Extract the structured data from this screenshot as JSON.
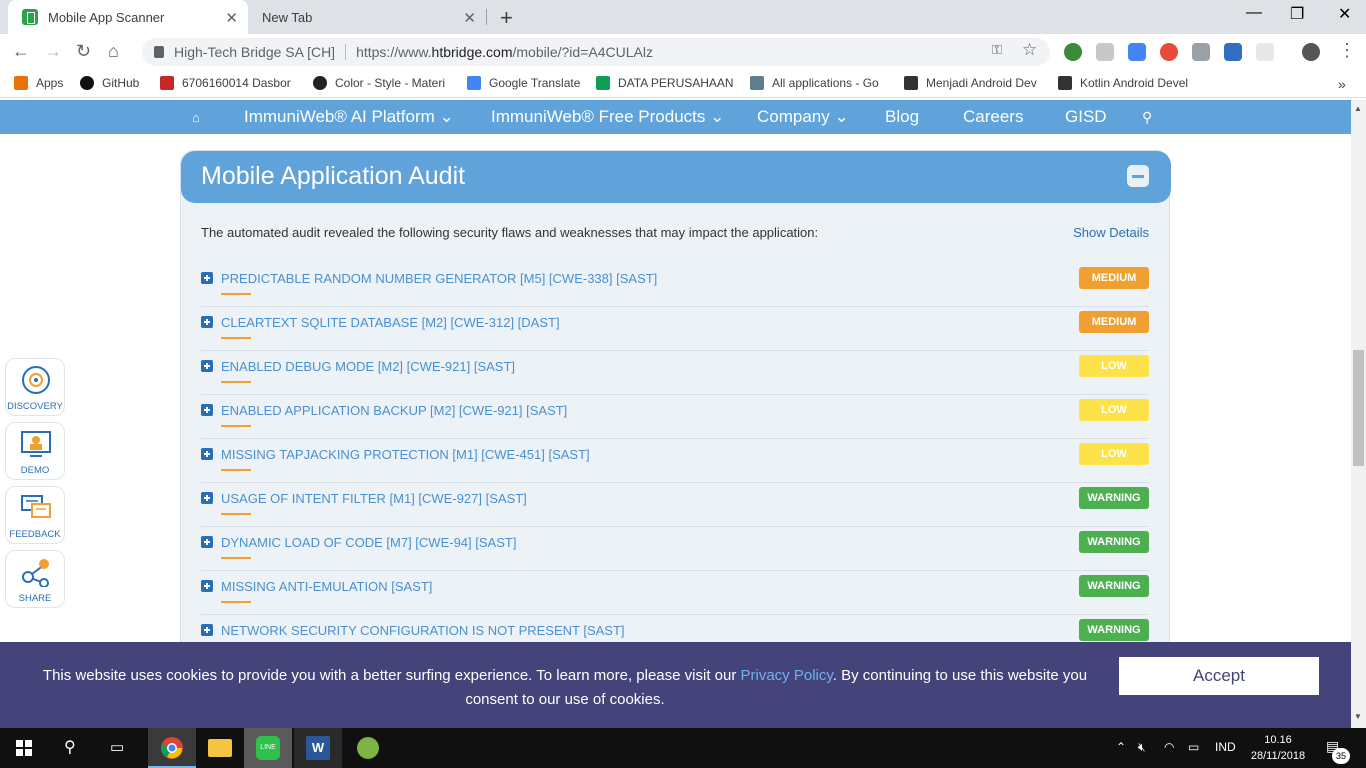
{
  "browser": {
    "tabs": [
      {
        "title": "Mobile App Scanner",
        "active": true
      },
      {
        "title": "New Tab",
        "active": false
      }
    ],
    "security_label": "High-Tech Bridge SA [CH]",
    "url_prefix": "https://www.",
    "url_domain": "htbridge.com",
    "url_suffix": "/mobile/?id=A4CULAlz",
    "bookmarks": [
      "Apps",
      "GitHub",
      "6706160014 Dasbor",
      "Color - Style - Materi",
      "Google Translate",
      "DATA PERUSAHAAN",
      "All applications - Go",
      "Menjadi Android Dev",
      "Kotlin Android Devel"
    ]
  },
  "sitenav": {
    "items": [
      "ImmuniWeb® AI Platform",
      "ImmuniWeb® Free Products",
      "Company",
      "Blog",
      "Careers",
      "GISD"
    ]
  },
  "sidebar": {
    "items": [
      "DISCOVERY",
      "DEMO",
      "FEEDBACK",
      "SHARE"
    ]
  },
  "audit": {
    "title": "Mobile Application Audit",
    "intro": "The automated audit revealed the following security flaws and weaknesses that may impact the application:",
    "show_details": "Show Details",
    "findings": [
      {
        "title": "PREDICTABLE RANDOM NUMBER GENERATOR [M5] [CWE-338] [SAST]",
        "severity": "MEDIUM"
      },
      {
        "title": "CLEARTEXT SQLITE DATABASE [M2] [CWE-312] [DAST]",
        "severity": "MEDIUM"
      },
      {
        "title": "ENABLED DEBUG MODE [M2] [CWE-921] [SAST]",
        "severity": "LOW"
      },
      {
        "title": "ENABLED APPLICATION BACKUP [M2] [CWE-921] [SAST]",
        "severity": "LOW"
      },
      {
        "title": "MISSING TAPJACKING PROTECTION [M1] [CWE-451] [SAST]",
        "severity": "LOW"
      },
      {
        "title": "USAGE OF INTENT FILTER [M1] [CWE-927] [SAST]",
        "severity": "WARNING"
      },
      {
        "title": "DYNAMIC LOAD OF CODE [M7] [CWE-94] [SAST]",
        "severity": "WARNING"
      },
      {
        "title": "MISSING ANTI-EMULATION [SAST]",
        "severity": "WARNING"
      },
      {
        "title": "NETWORK SECURITY CONFIGURATION IS NOT PRESENT [SAST]",
        "severity": "WARNING"
      }
    ],
    "severity_colors": {
      "MEDIUM": "#f0a030",
      "LOW": "#fde24a",
      "WARNING": "#4caf50"
    }
  },
  "cookie": {
    "text_before": "This website uses cookies to provide you with a better surfing experience. To learn more, please visit our ",
    "link": "Privacy Policy",
    "text_after": ". By continuing to use this website you consent to our use of cookies.",
    "accept": "Accept"
  },
  "taskbar": {
    "lang": "IND",
    "time": "10.16",
    "date": "28/11/2018",
    "notifications": "35"
  }
}
